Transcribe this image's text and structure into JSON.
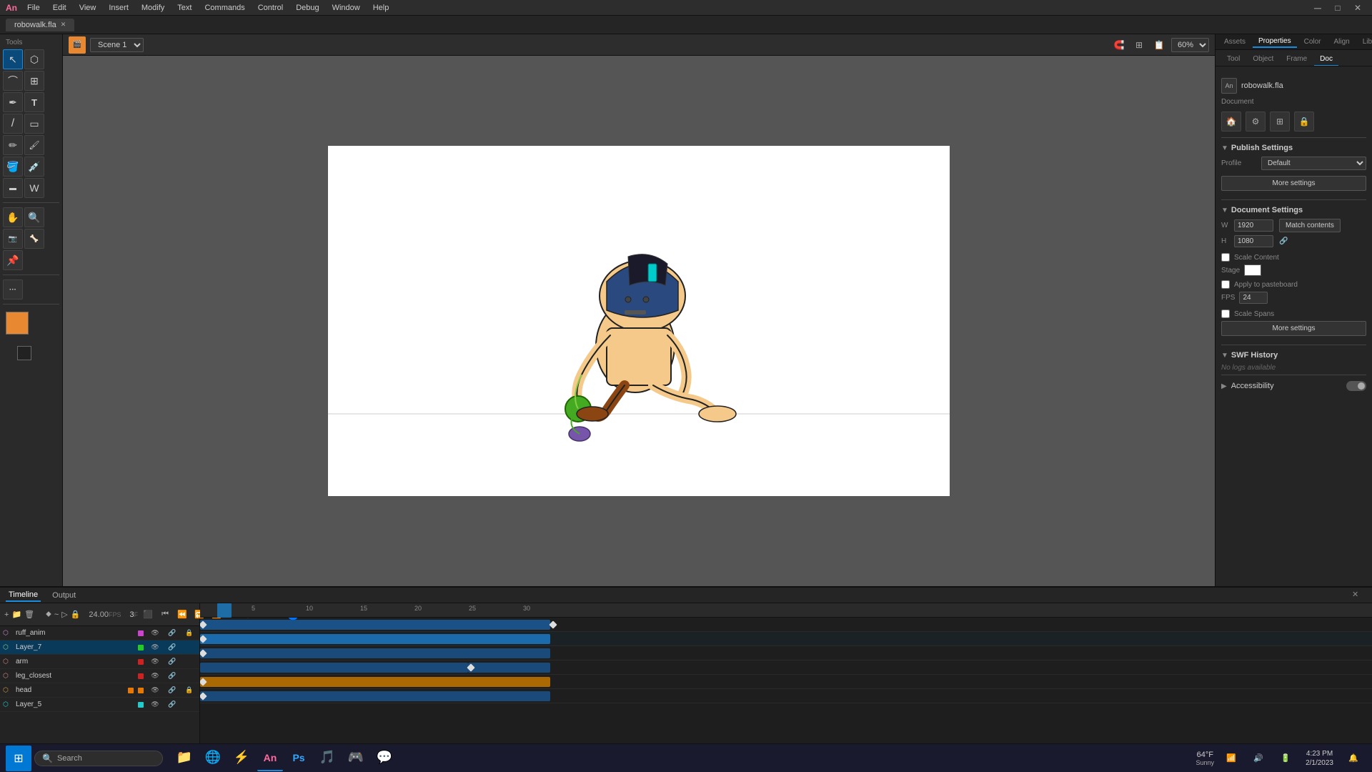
{
  "app": {
    "name": "Adobe Animate",
    "logo": "An"
  },
  "menubar": {
    "items": [
      "File",
      "Edit",
      "View",
      "Insert",
      "Modify",
      "Text",
      "Commands",
      "Control",
      "Debug",
      "Window",
      "Help"
    ]
  },
  "tab": {
    "filename": "robowalk.fla",
    "dirty": true
  },
  "toolbar_canvas": {
    "scene": "Scene 1",
    "zoom": "60%"
  },
  "right_panel": {
    "top_tabs": [
      "Assets",
      "Properties",
      "Color",
      "Align",
      "Library"
    ],
    "active_top_tab": "Properties",
    "sub_tabs": [
      "Tool",
      "Object",
      "Frame",
      "Doc"
    ],
    "active_sub_tab": "Doc",
    "doc_filename": "robowalk.fla",
    "doc_label": "Document"
  },
  "publish_settings": {
    "section_title": "Publish Settings",
    "profile_label": "Profile",
    "profile_value": "Default",
    "more_settings_btn": "More settings"
  },
  "document_settings": {
    "section_title": "Document Settings",
    "w_label": "W",
    "w_value": "1920",
    "h_label": "H",
    "h_value": "1080",
    "match_contents_btn": "Match contents",
    "scale_content_label": "Scale Content",
    "apply_to_pasteboard_label": "Apply to pasteboard",
    "scale_spans_label": "Scale Spans",
    "stage_label": "Stage",
    "fps_label": "FPS",
    "fps_value": "24",
    "more_settings_btn2": "More settings"
  },
  "swf_history": {
    "section_title": "SWF History",
    "no_logs": "No logs available"
  },
  "accessibility": {
    "label": "Accessibility"
  },
  "timeline": {
    "tabs": [
      "Timeline",
      "Output"
    ],
    "active_tab": "Timeline",
    "fps": "24.00",
    "fps_label": "FPS",
    "frame": "3",
    "frame_label": "F",
    "layers": [
      {
        "name": "ruff_anim",
        "color": "#cc44cc",
        "locked": true,
        "selected": false
      },
      {
        "name": "Layer_7",
        "color": "#22cc22",
        "locked": false,
        "selected": true
      },
      {
        "name": "arm",
        "color": "#cc2222",
        "locked": false,
        "selected": false
      },
      {
        "name": "leg_closest",
        "color": "#cc2222",
        "locked": false,
        "selected": false
      },
      {
        "name": "head",
        "color": "#e87800",
        "locked": true,
        "selected": false
      },
      {
        "name": "Layer_5",
        "color": "#22cccc",
        "locked": false,
        "selected": false
      }
    ],
    "ruler_marks": [
      "5",
      "10",
      "15",
      "20",
      "25",
      "30"
    ]
  },
  "taskbar": {
    "search_placeholder": "Search",
    "time": "4:23 PM",
    "date": "2/1/2023",
    "weather_temp": "64°F",
    "weather_desc": "Sunny"
  },
  "tools": {
    "items": [
      {
        "name": "selection",
        "icon": "↖",
        "active": true
      },
      {
        "name": "subselection",
        "icon": "⬡"
      },
      {
        "name": "lasso",
        "icon": "⌒"
      },
      {
        "name": "pen",
        "icon": "✒"
      },
      {
        "name": "text",
        "icon": "T"
      },
      {
        "name": "line",
        "icon": "/"
      },
      {
        "name": "rect",
        "icon": "▭"
      },
      {
        "name": "pencil",
        "icon": "✏"
      },
      {
        "name": "brush",
        "icon": "🖌"
      },
      {
        "name": "paint",
        "icon": "🪣"
      },
      {
        "name": "eyedropper",
        "icon": "💉"
      },
      {
        "name": "eraser",
        "icon": "⬜"
      },
      {
        "name": "hand",
        "icon": "✋"
      },
      {
        "name": "zoom",
        "icon": "🔍"
      },
      {
        "name": "camera",
        "icon": "📷"
      },
      {
        "name": "bone",
        "icon": "🦴"
      },
      {
        "name": "pin",
        "icon": "📌"
      },
      {
        "name": "more",
        "icon": "···"
      }
    ]
  }
}
